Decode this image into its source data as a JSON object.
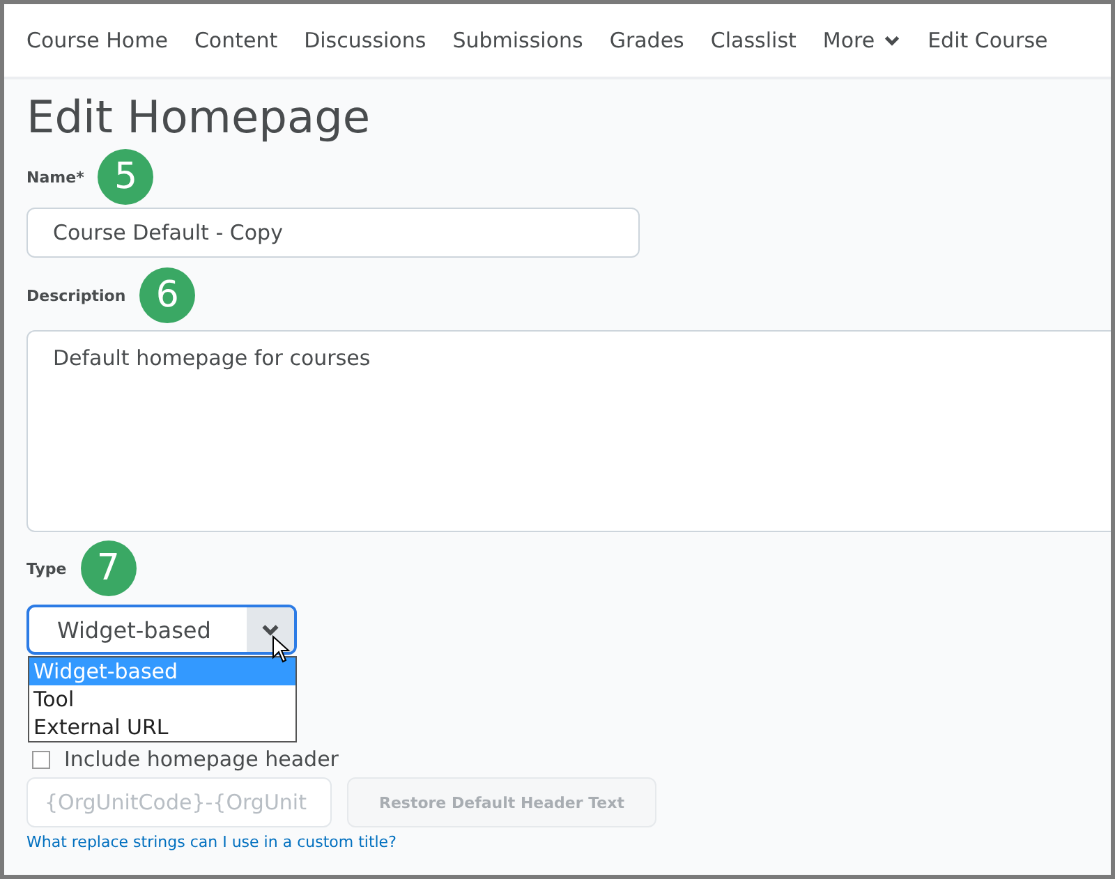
{
  "nav": {
    "items": [
      {
        "label": "Course Home",
        "kind": "link"
      },
      {
        "label": "Content",
        "kind": "link"
      },
      {
        "label": "Discussions",
        "kind": "link"
      },
      {
        "label": "Submissions",
        "kind": "link"
      },
      {
        "label": "Grades",
        "kind": "link"
      },
      {
        "label": "Classlist",
        "kind": "link"
      },
      {
        "label": "More",
        "kind": "menu"
      },
      {
        "label": "Edit Course",
        "kind": "link"
      }
    ]
  },
  "title": "Edit Homepage",
  "name_field": {
    "label": "Name",
    "required_mark": "*",
    "badge": "5",
    "value": "Course Default - Copy"
  },
  "description_field": {
    "label": "Description",
    "badge": "6",
    "value": "Default homepage for courses"
  },
  "type_field": {
    "label": "Type",
    "badge": "7",
    "value": "Widget-based",
    "expanded": true,
    "options": [
      {
        "label": "Widget-based",
        "selected": true
      },
      {
        "label": "Tool",
        "selected": false
      },
      {
        "label": "External URL",
        "selected": false
      }
    ]
  },
  "header_checkbox": {
    "label": "Include homepage header",
    "checked": false
  },
  "header_field": {
    "placeholder": "{OrgUnitCode}-{OrgUnit"
  },
  "restore_button": {
    "label": "Restore Default Header Text",
    "disabled": true
  },
  "help_link": "What replace strings can I use in a custom title?"
}
